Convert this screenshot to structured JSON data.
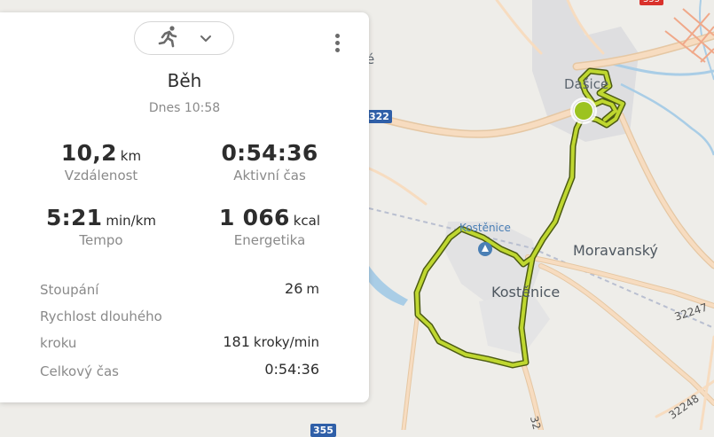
{
  "activity": {
    "title": "Běh",
    "date": "Dnes 10:58",
    "type_icon": "running-person-icon",
    "dropdown_icon": "chevron-down-icon",
    "menu_icon": "more-vertical-icon"
  },
  "stats": [
    {
      "value": "10,2",
      "unit": "km",
      "label": "Vzdálenost"
    },
    {
      "value": "0:54:36",
      "unit": "",
      "label": "Aktivní čas"
    },
    {
      "value": "5:21",
      "unit": "min/km",
      "label": "Tempo"
    },
    {
      "value": "1 066",
      "unit": "kcal",
      "label": "Energetika"
    }
  ],
  "details": [
    {
      "label": "Stoupání",
      "value": "26",
      "unit": "m"
    },
    {
      "label": "Rychlost dlouhého",
      "value": "",
      "unit": ""
    },
    {
      "label": "kroku",
      "value": "181",
      "unit": "kroky/min"
    },
    {
      "label": "Celkový čas",
      "value": "0:54:36",
      "unit": ""
    }
  ],
  "map": {
    "labels": {
      "dasice": "Dašice",
      "kostenice_stop": "Kostěnice",
      "kostenice": "Kostěnice",
      "moravansky": "Moravanský",
      "road_32247": "32247",
      "road_32248": "32248",
      "road_32": "32",
      "shield_322": "322",
      "shield_355": "355",
      "shield_red": "355",
      "edge_e": "é"
    },
    "colors": {
      "route": "#bfd730",
      "route_outline": "#4c5b12",
      "water": "#a9cde6",
      "road": "#f7dcc0",
      "road_edge": "#e5c7a3"
    },
    "icons": {
      "bus_stop": "bus-stop-icon",
      "current_position": "current-position-marker"
    }
  }
}
